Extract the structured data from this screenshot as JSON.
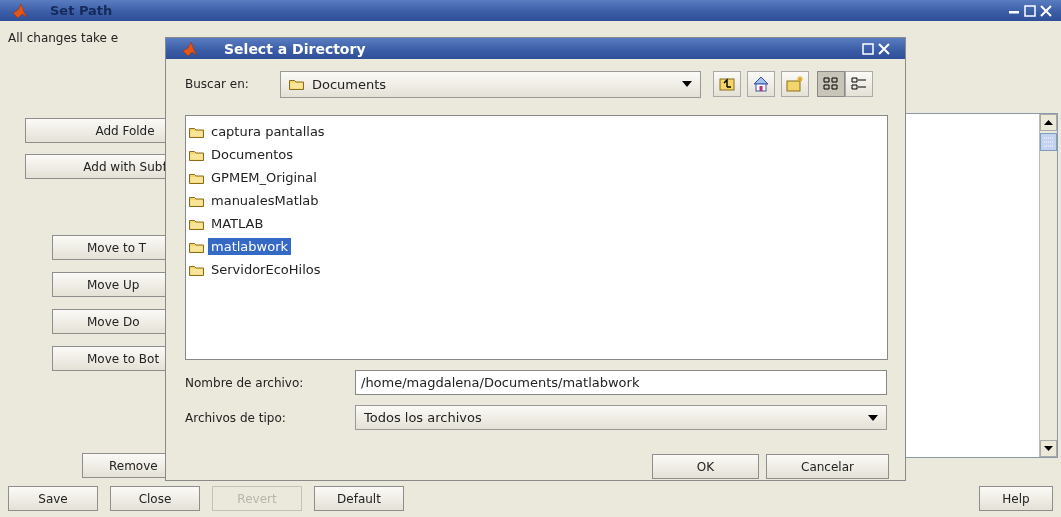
{
  "window": {
    "title": "Set Path"
  },
  "intro": "All changes take e",
  "add_buttons": [
    {
      "label": "Add Folde"
    },
    {
      "label": "Add with Subf"
    }
  ],
  "move_buttons": [
    {
      "label": "Move to T"
    },
    {
      "label": "Move Up"
    },
    {
      "label": "Move Do"
    },
    {
      "label": "Move to Bot"
    }
  ],
  "remove_button": {
    "label": "Remove"
  },
  "bottom_buttons": [
    {
      "label": "Save",
      "disabled": false
    },
    {
      "label": "Close",
      "disabled": false
    },
    {
      "label": "Revert",
      "disabled": true
    },
    {
      "label": "Default",
      "disabled": false
    }
  ],
  "help_button": {
    "label": "Help"
  },
  "dialog": {
    "title": "Select a Directory",
    "look_in_label": "Buscar en:",
    "look_in_value": "Documents",
    "toolbar": [
      {
        "kind": "up"
      },
      {
        "kind": "home"
      },
      {
        "kind": "new_folder"
      }
    ],
    "views": [
      {
        "kind": "list",
        "selected": true
      },
      {
        "kind": "details",
        "selected": false
      }
    ],
    "files": [
      {
        "name": "captura pantallas",
        "selected": false
      },
      {
        "name": "Documentos",
        "selected": false
      },
      {
        "name": "GPMEM_Original",
        "selected": false
      },
      {
        "name": "manualesMatlab",
        "selected": false
      },
      {
        "name": "MATLAB",
        "selected": false
      },
      {
        "name": "matlabwork",
        "selected": true
      },
      {
        "name": "ServidorEcoHilos",
        "selected": false
      }
    ],
    "filename_label": "Nombre de archivo:",
    "filename_value": "/home/magdalena/Documents/matlabwork",
    "filetype_label": "Archivos de tipo:",
    "filetype_value": "Todos los archivos",
    "buttons": [
      "OK",
      "Cancelar"
    ]
  }
}
